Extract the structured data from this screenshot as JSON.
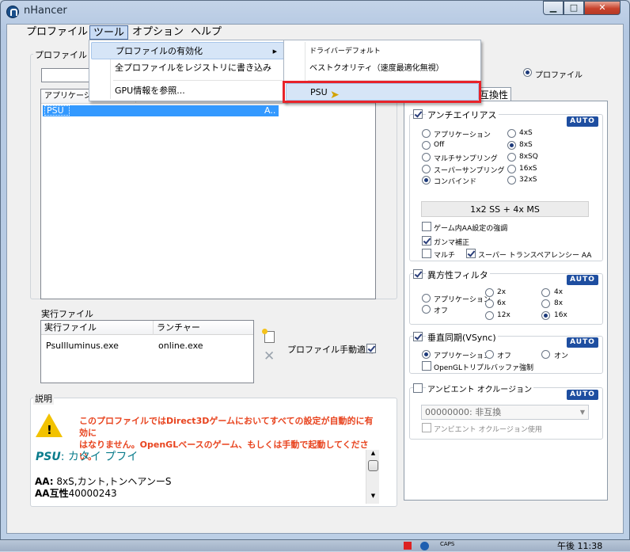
{
  "window": {
    "title": "nHancer",
    "minimize_glyph": "▁",
    "maximize_glyph": "□",
    "close_glyph": "✕"
  },
  "menubar": {
    "items": [
      "プロファイル",
      "ツール",
      "オプション",
      "ヘルプ"
    ]
  },
  "tools_menu": {
    "items": [
      "プロファイルの有効化",
      "全プロファイルをレジストリに書き込み",
      "GPU情報を参照..."
    ],
    "submenu_arrow": "▶"
  },
  "submenu": {
    "items": [
      "ドライバーデフォルト",
      "ベストクオリティ（速度最適化無視）",
      "PSU"
    ]
  },
  "profile_panel": {
    "group_label": "プロファイル",
    "columns": [
      "アプリケーション"
    ],
    "selected_row": {
      "name": "PSU",
      "tail": "A.."
    }
  },
  "exec_panel": {
    "group_label": "実行ファイル",
    "columns": [
      "実行ファイル",
      "ランチャー"
    ],
    "rows": [
      {
        "exe": "PsuIlluminus.exe",
        "launcher": "online.exe"
      }
    ],
    "manual_label": "プロファイル手動適用"
  },
  "description": {
    "group_label": "説明",
    "warning": "このプロファイルではDirect3Dゲームにおいてすべての設定が自動的に有効に\nはなりません。OpenGLベースのゲーム、もしくは手動で起動してください。",
    "profile_name": "PSU",
    "profile_sub": ": カタイ プフイ",
    "lines": [
      {
        "key": "AA:",
        "value": " 8xS,カント,トンヘアンーS"
      },
      {
        "key": "AA互性",
        "value": "40000243"
      }
    ]
  },
  "right_panel": {
    "radio_label": "プロファイル",
    "tab_label": "互換性",
    "aa": {
      "title": "アンチエイリアス",
      "auto": "AUTO",
      "left_options": [
        "アプリケーション",
        "Off",
        "マルチサンプリング",
        "スーパーサンプリング",
        "コンバインド"
      ],
      "right_options": [
        "4xS",
        "8xS",
        "8xSQ",
        "16xS",
        "32xS"
      ],
      "selected_left": "コンバインド",
      "selected_right": "8xS",
      "mode_button": "1x2 SS + 4x MS",
      "ingame": "ゲーム内AA設定の強調",
      "gamma": "ガンマ補正",
      "multi": "マルチ",
      "super_trans": "スーパー トランスペアレンシー AA"
    },
    "af": {
      "title": "異方性フィルタ",
      "auto": "AUTO",
      "col1": [
        "アプリケーション",
        "オフ"
      ],
      "col2": [
        "2x",
        "6x",
        "12x"
      ],
      "col3": [
        "4x",
        "8x",
        "16x"
      ],
      "selected": "16x"
    },
    "vsync": {
      "title": "垂直同期(VSync)",
      "auto": "AUTO",
      "options": [
        "アプリケーション",
        "オフ",
        "オン"
      ],
      "selected": "アプリケーション",
      "triple": "OpenGLトリプルバッファ強制"
    },
    "ao": {
      "title": "アンビエント オクルージョン",
      "auto": "AUTO",
      "select_value": "00000000: 非互換",
      "use_label": "アンビエント オクルージョン使用"
    }
  },
  "taskbar": {
    "caps": "CAPS",
    "time": "午後 11:38"
  }
}
